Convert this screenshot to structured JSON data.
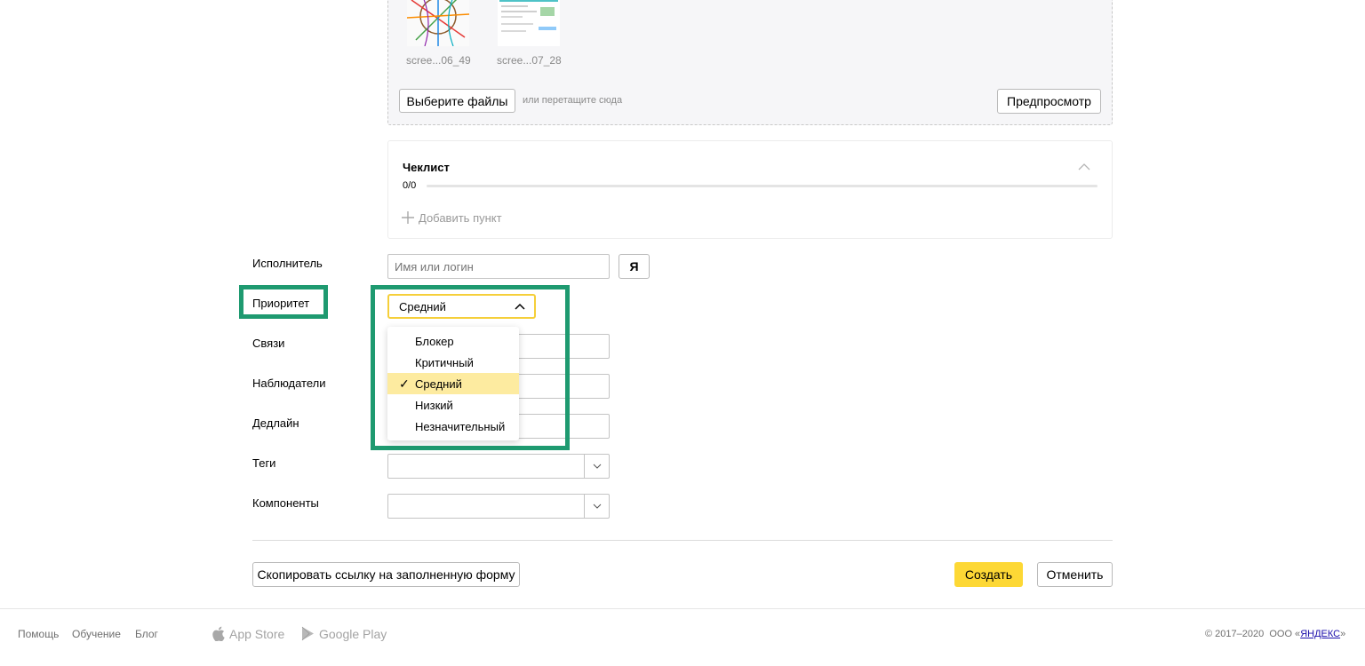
{
  "attachments": {
    "files": [
      {
        "name": "scree...06_49",
        "icon": "metro-map-thumbnail"
      },
      {
        "name": "scree...07_28",
        "icon": "screenshot-thumbnail"
      }
    ],
    "choose_label": "Выберите файлы",
    "drop_hint": "или перетащите сюда",
    "preview_label": "Предпросмотр"
  },
  "checklist": {
    "title": "Чеклист",
    "count": "0/0",
    "progress": 0,
    "add_label": "Добавить пункт"
  },
  "form": {
    "assignee_label": "Исполнитель",
    "assignee_placeholder": "Имя или логин",
    "me_button": "Я",
    "priority_label": "Приоритет",
    "priority_value": "Средний",
    "links_label": "Связи",
    "followers_label": "Наблюдатели",
    "deadline_label": "Дедлайн",
    "tags_label": "Теги",
    "components_label": "Компоненты"
  },
  "priority_menu": {
    "items": [
      "Блокер",
      "Критичный",
      "Средний",
      "Низкий",
      "Незначительный"
    ],
    "selected": "Средний",
    "check_mark": "✓"
  },
  "actions": {
    "copy_link": "Скопировать ссылку на заполненную форму",
    "create": "Создать",
    "cancel": "Отменить"
  },
  "footer": {
    "links": [
      "Помощь",
      "Обучение",
      "Блог"
    ],
    "app_store": "App Store",
    "google_play": "Google Play",
    "copyright_prefix": "© 2017–2020  ООО «",
    "copyright_link": "ЯНДЕКС",
    "copyright_suffix": "»"
  },
  "colors": {
    "accent_yellow": "#fdd835",
    "highlight_green": "#1e9a70",
    "selected_bg": "#fdeba0"
  }
}
